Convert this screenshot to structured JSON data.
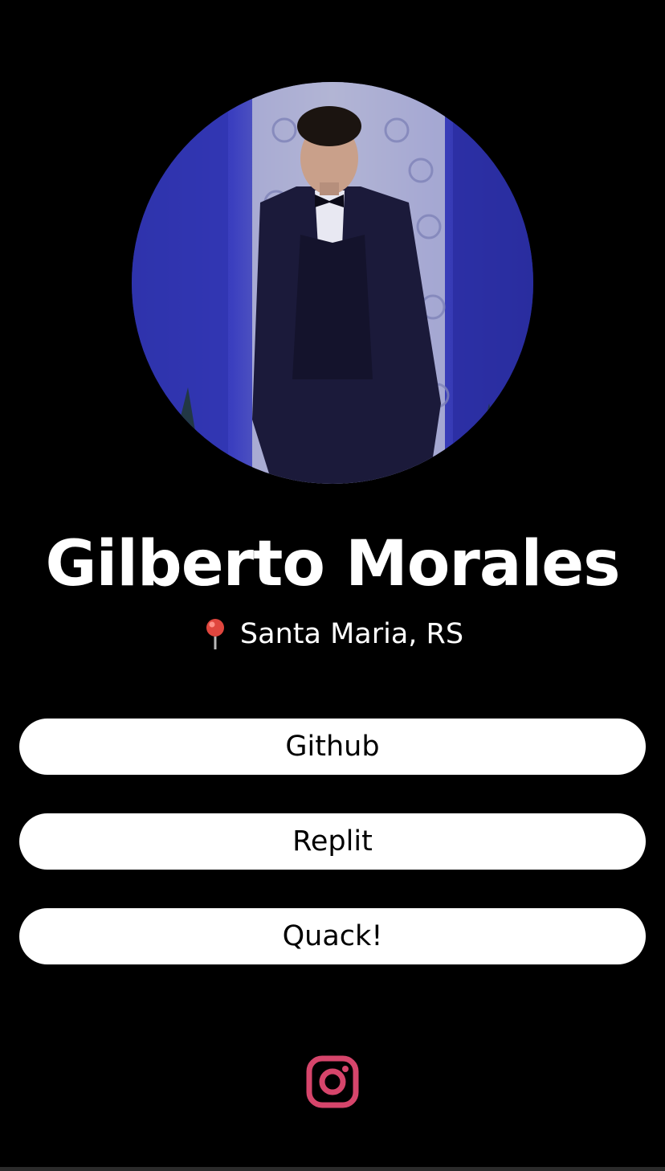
{
  "profile": {
    "name": "Gilberto Morales",
    "location": "Santa Maria, RS",
    "location_icon": "map-pin-icon"
  },
  "links": [
    {
      "label": "Github"
    },
    {
      "label": "Replit"
    },
    {
      "label": "Quack!"
    }
  ],
  "social": {
    "icon": "instagram-icon",
    "color": "#d6456b"
  },
  "colors": {
    "background": "#000000",
    "text": "#ffffff",
    "button_bg": "#ffffff",
    "button_text": "#000000"
  }
}
